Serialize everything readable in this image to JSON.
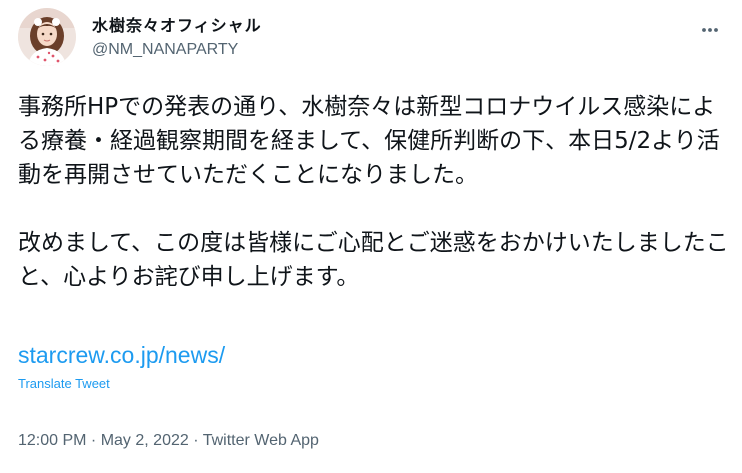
{
  "author": {
    "display_name": "水樹奈々オフィシャル",
    "handle": "@NM_NANAPARTY"
  },
  "tweet": {
    "text_paragraph_1": "事務所HPでの発表の通り、水樹奈々は新型コロナウイルス感染による療養・経過観察期間を経まして、保健所判断の下、本日5/2より活動を再開させていただくことになりました。",
    "text_paragraph_2": "改めまして、この度は皆様にご心配とご迷惑をおかけいたしましたこと、心よりお詫び申し上げます。",
    "link_text": "starcrew.co.jp/news/",
    "translate_label": "Translate Tweet",
    "time": "12:00 PM",
    "date": "May 2, 2022",
    "source": "Twitter Web App",
    "separator": " · "
  },
  "icons": {
    "more": "more-horizontal-icon",
    "avatar": "profile-avatar"
  },
  "colors": {
    "link": "#1d9bf0",
    "secondary_text": "#536471",
    "primary_text": "#0f1419"
  }
}
